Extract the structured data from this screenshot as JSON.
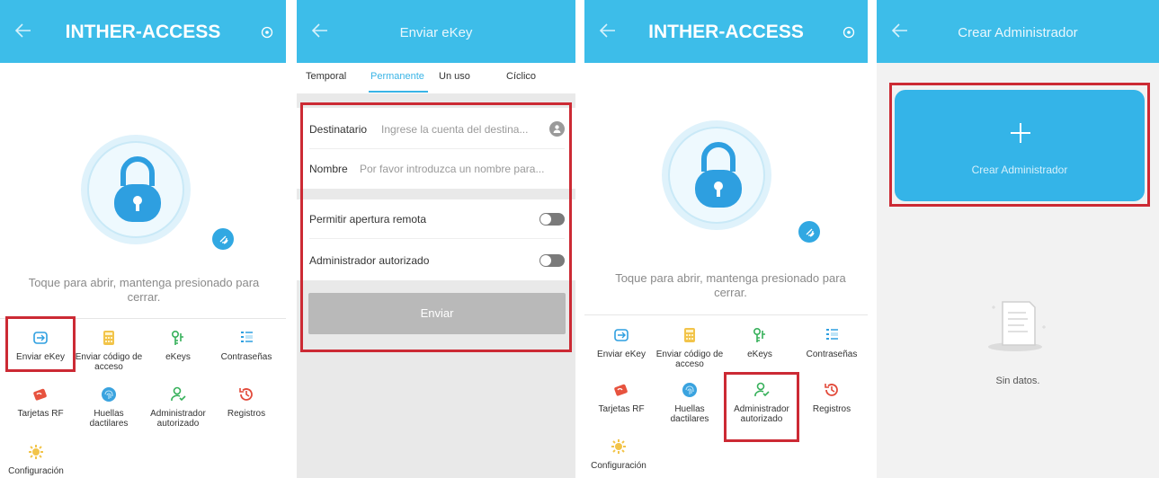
{
  "panel1": {
    "header_title": "INTHER-ACCESS",
    "hint": "Toque para abrir, mantenga presionado para cerrar.",
    "grid": [
      {
        "label": "Enviar eKey",
        "icon": "send-ekey-icon"
      },
      {
        "label": "Enviar código de acceso",
        "icon": "passcode-icon"
      },
      {
        "label": "eKeys",
        "icon": "ekeys-icon"
      },
      {
        "label": "Contraseñas",
        "icon": "passwords-icon"
      },
      {
        "label": "Tarjetas RF",
        "icon": "rf-card-icon"
      },
      {
        "label": "Huellas dactilares",
        "icon": "fingerprint-icon"
      },
      {
        "label": "Administrador autorizado",
        "icon": "authorized-admin-icon"
      },
      {
        "label": "Registros",
        "icon": "records-icon"
      },
      {
        "label": "Configuración",
        "icon": "settings-icon"
      }
    ]
  },
  "panel2": {
    "header_title": "Enviar eKey",
    "tabs": [
      "Temporal",
      "Permanente",
      "Un uso",
      "Cíclico"
    ],
    "active_tab": "Permanente",
    "recipient_label": "Destinatario",
    "recipient_placeholder": "Ingrese la cuenta del destina...",
    "name_label": "Nombre",
    "name_placeholder": "Por favor introduzca un nombre para...",
    "remote_open_label": "Permitir apertura remota",
    "authorized_admin_label": "Administrador autorizado",
    "send_label": "Enviar"
  },
  "panel3": {
    "header_title": "INTHER-ACCESS",
    "hint": "Toque para abrir, mantenga presionado para cerrar.",
    "grid": [
      {
        "label": "Enviar eKey",
        "icon": "send-ekey-icon"
      },
      {
        "label": "Enviar código de acceso",
        "icon": "passcode-icon"
      },
      {
        "label": "eKeys",
        "icon": "ekeys-icon"
      },
      {
        "label": "Contraseñas",
        "icon": "passwords-icon"
      },
      {
        "label": "Tarjetas RF",
        "icon": "rf-card-icon"
      },
      {
        "label": "Huellas dactilares",
        "icon": "fingerprint-icon"
      },
      {
        "label": "Administrador autorizado",
        "icon": "authorized-admin-icon"
      },
      {
        "label": "Registros",
        "icon": "records-icon"
      },
      {
        "label": "Configuración",
        "icon": "settings-icon"
      }
    ]
  },
  "panel4": {
    "header_title": "Crear Administrador",
    "create_label": "Crear Administrador",
    "empty_text": "Sin datos."
  },
  "colors": {
    "brand_blue": "#3dbde9",
    "highlight_red": "#cc2a34",
    "disabled_button": "#b9b9b9"
  }
}
